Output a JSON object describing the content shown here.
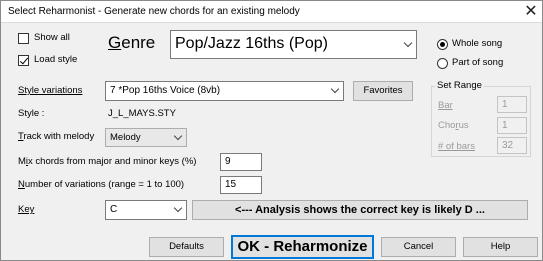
{
  "window": {
    "title": "Select Reharmonist  - Generate new chords for an existing melody",
    "close_glyph": "✕"
  },
  "options": {
    "show_all": {
      "label": "Show all",
      "checked": false
    },
    "load_style": {
      "label": "Load style",
      "checked": true
    }
  },
  "genre": {
    "label": "Genre",
    "value": "Pop/Jazz 16ths (Pop)"
  },
  "scope": {
    "whole_song": {
      "label": "Whole song",
      "selected": true
    },
    "part_of_song": {
      "label": "Part of song",
      "selected": false
    }
  },
  "style_variations": {
    "label": "Style variations",
    "value": "7 *Pop 16ths Voice (8vb)",
    "favorites_label": "Favorites"
  },
  "style": {
    "label": "Style :",
    "value": "J_L_MAYS.STY"
  },
  "track": {
    "label": "Track with melody",
    "value": "Melody"
  },
  "mix": {
    "label": "Mix chords from major and minor keys (%)",
    "value": "9"
  },
  "variations": {
    "label": "Number of variations (range = 1 to 100)",
    "value": "15"
  },
  "key": {
    "label": "Key",
    "value": "C",
    "analysis_label": "<--- Analysis shows the correct key is likely D  ..."
  },
  "set_range": {
    "title": "Set Range",
    "bar_label": "Bar",
    "bar_value": "1",
    "chorus_label": "Chorus",
    "chorus_value": "1",
    "bars_label": "# of bars",
    "bars_value": "32"
  },
  "buttons": {
    "defaults": "Defaults",
    "ok": "OK - Reharmonize",
    "cancel": "Cancel",
    "help": "Help"
  },
  "colors": {
    "focus_border": "#0078d7",
    "dialog_bg": "#f0f0f0"
  }
}
